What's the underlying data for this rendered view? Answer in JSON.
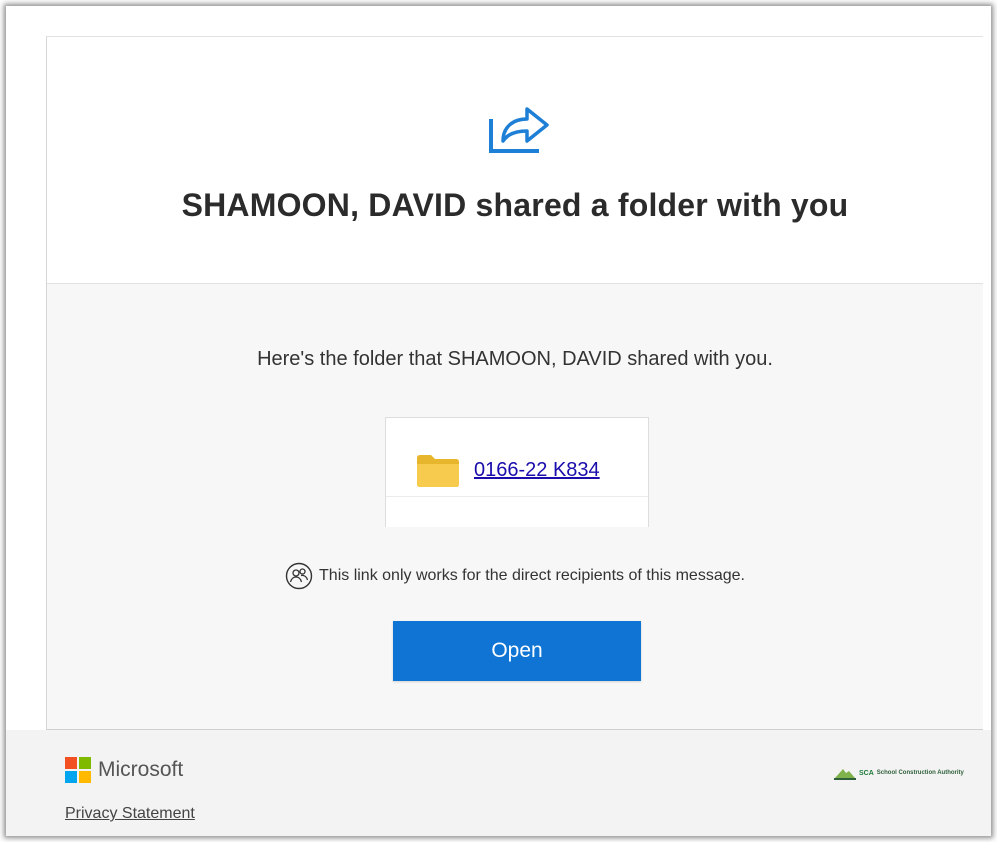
{
  "header": {
    "title": "SHAMOON, DAVID shared a folder with you",
    "share_icon": "share-arrow-icon"
  },
  "body": {
    "description": "Here's the folder that SHAMOON, DAVID shared with you.",
    "file": {
      "name": "0166-22 K834",
      "icon": "folder-icon"
    },
    "note": "This link only works for the direct recipients of this message.",
    "open_label": "Open"
  },
  "footer": {
    "brand": "Microsoft",
    "privacy_label": "Privacy Statement",
    "partner_abbr": "SCA",
    "partner_name": "School Construction Authority"
  },
  "colors": {
    "accent": "#0f74d4",
    "link": "#1a0dab",
    "folder": "#f4c542",
    "share_icon": "#1e7fd6"
  }
}
